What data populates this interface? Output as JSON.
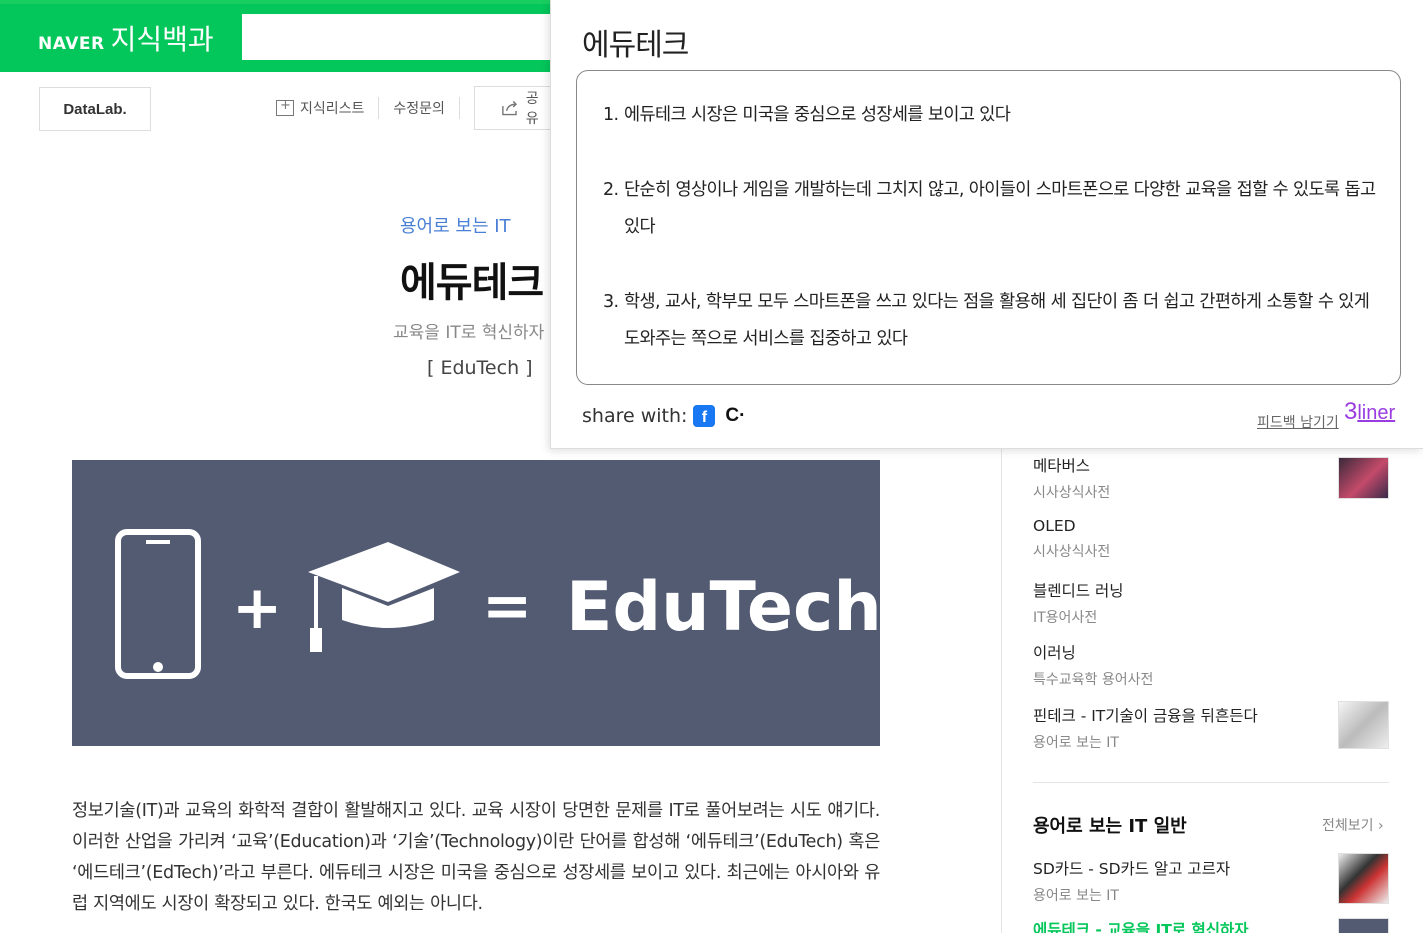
{
  "header": {
    "brand": "NAVER",
    "service": "지식백과"
  },
  "toolbar": {
    "datalab": "DataLab.",
    "add_list": "지식리스트",
    "edit_request": "수정문의",
    "share": "공유"
  },
  "article": {
    "category": "용어로 보는 IT",
    "title": "에듀테크",
    "subtitle": "교육을 IT로 혁신하자",
    "english": "[ EduTech ]",
    "hero_text": "EduTech",
    "paragraph": "정보기술(IT)과 교육의 화학적 결합이 활발해지고 있다. 교육 시장이 당면한 문제를 IT로 풀어보려는 시도 얘기다. 이러한 산업을 가리켜 ‘교육’(Education)과 ‘기술’(Technology)이란 단어를 합성해 ‘에듀테크’(EduTech) 혹은 ‘에드테크’(EdTech)’라고 부른다. 에듀테크 시장은 미국을 중심으로 성장세를 보이고 있다. 최근에는 아시아와 유럽 지역에도 시장이 확장되고 있다. 한국도 예외는 아니다."
  },
  "sidebar": {
    "related": [
      {
        "title": "메타버스",
        "source": "시사상식사전"
      },
      {
        "title": "OLED",
        "source": "시사상식사전"
      },
      {
        "title": "블렌디드 러닝",
        "source": "IT용어사전"
      },
      {
        "title": "이러닝",
        "source": "특수교육학 용어사전"
      },
      {
        "title": "핀테크 - IT기술이 금융을 뒤흔든다",
        "source": "용어로 보는 IT"
      }
    ],
    "section_title": "용어로 보는 IT 일반",
    "more": "전체보기 ›",
    "section_items": [
      {
        "title": "SD카드 - SD카드 알고 고르자",
        "source": "용어로 보는 IT"
      },
      {
        "title": "에듀테크 - 교육을 IT로 혁신하자",
        "source": ""
      }
    ]
  },
  "popup": {
    "title": "에듀테크",
    "items": [
      {
        "num": "1.",
        "text": "에듀테크 시장은 미국을 중심으로 성장세를 보이고 있다"
      },
      {
        "num": "2.",
        "text": "단순히 영상이나 게임을 개발하는데 그치지 않고, 아이들이 스마트폰으로 다양한 교육을 접할 수 있도록 돕고 있다"
      },
      {
        "num": "3.",
        "text": "학생, 교사, 학부모 모두 스마트폰을 쓰고 있다는 점을 활용해 세 집단이 좀 더 쉽고 간편하게 소통할 수 있게 도와주는 쪽으로 서비스를 집중하고 있다"
      }
    ],
    "share_label": "share with:",
    "feedback": "피드백 남기기",
    "brand_big": "3",
    "brand_small": "liner"
  },
  "colors": {
    "naver_green": "#03c75a",
    "link_blue": "#4a7fd6",
    "liner_purple": "#9a3de0"
  }
}
